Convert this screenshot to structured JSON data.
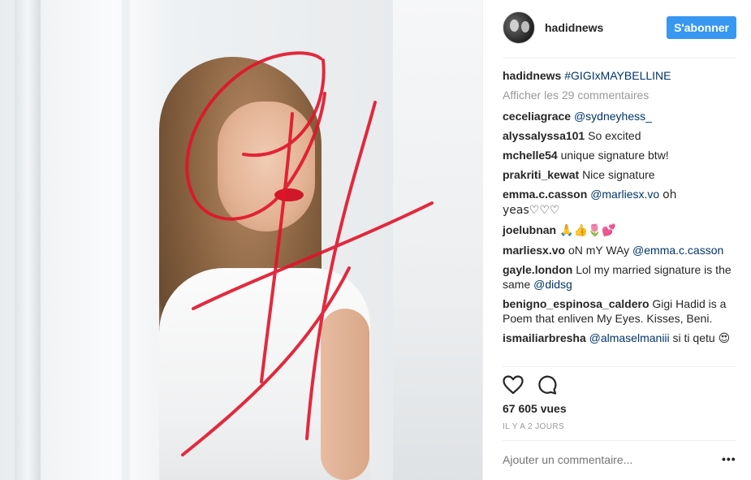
{
  "post": {
    "username": "hadidnews",
    "follow_label": "S'abonner",
    "caption_user": "hadidnews",
    "caption_text": "#GIGIxMAYBELLINE",
    "view_all": "Afficher les 29 commentaires",
    "views": "67 605 vues",
    "timestamp": "IL Y A 2 JOURS",
    "add_comment_placeholder": "Ajouter un commentaire...",
    "options_label": "•••"
  },
  "comments": [
    {
      "user": "ceceliagrace",
      "mention": "@sydneyhess_",
      "text": ""
    },
    {
      "user": "alyssalyssa101",
      "text": "So excited"
    },
    {
      "user": "mchelle54",
      "text": "unique signature btw!"
    },
    {
      "user": "prakriti_kewat",
      "text": "Nice signature"
    },
    {
      "user": "emma.c.casson",
      "mention": "@marliesx.vo",
      "text": "oh yeas♡♡♡"
    },
    {
      "user": "joelubnan",
      "text": "🙏👍🌷💕"
    },
    {
      "user": "marliesx.vo",
      "text": "oN mY WAy",
      "mention": "@emma.c.casson"
    },
    {
      "user": "gayle.london",
      "text": "Lol my married signature is the same",
      "mention": "@didsg"
    },
    {
      "user": "benigno_espinosa_caldero",
      "text": "Gigi Hadid is a Poem that enliven My Eyes. Kisses, Beni."
    },
    {
      "user": "ismailiarbresha",
      "mention": "@almaselmaniii",
      "text": "si ti qetu",
      "emoji": "😍"
    }
  ],
  "icons": {
    "like": "heart-icon",
    "comment": "speech-bubble-icon",
    "options": "more-options-icon"
  },
  "colors": {
    "accent": "#3897f0",
    "link": "#003569",
    "signature": "#e0142a"
  }
}
